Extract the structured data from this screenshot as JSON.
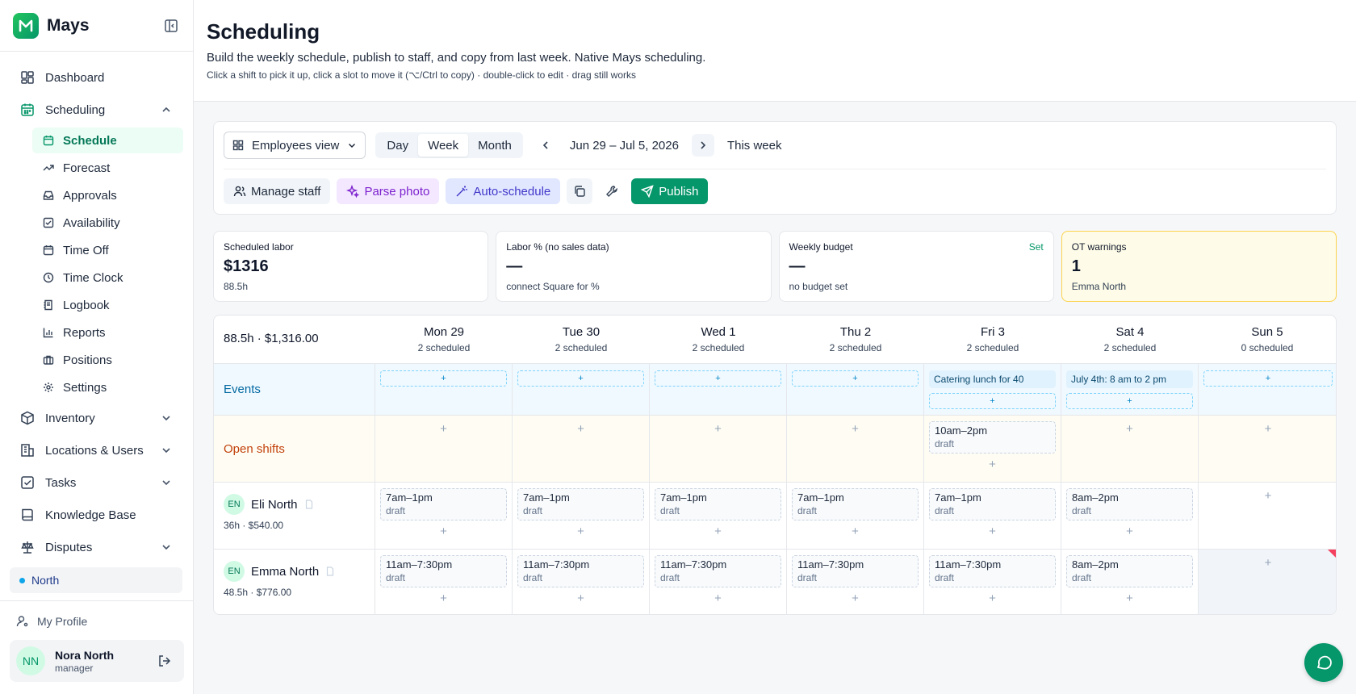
{
  "brand": {
    "name": "Mays"
  },
  "sidebar": {
    "nav": [
      {
        "label": "Dashboard"
      },
      {
        "label": "Scheduling"
      }
    ],
    "scheduling_sub": [
      {
        "label": "Schedule"
      },
      {
        "label": "Forecast"
      },
      {
        "label": "Approvals"
      },
      {
        "label": "Availability"
      },
      {
        "label": "Time Off"
      },
      {
        "label": "Time Clock"
      },
      {
        "label": "Logbook"
      },
      {
        "label": "Reports"
      },
      {
        "label": "Positions"
      },
      {
        "label": "Settings"
      }
    ],
    "nav_bottom": [
      {
        "label": "Inventory"
      },
      {
        "label": "Locations & Users"
      },
      {
        "label": "Tasks"
      },
      {
        "label": "Knowledge Base"
      },
      {
        "label": "Disputes"
      }
    ],
    "location": "North",
    "my_profile": "My Profile",
    "user": {
      "initials": "NN",
      "name": "Nora North",
      "role": "manager"
    }
  },
  "page": {
    "title": "Scheduling",
    "subtitle": "Build the weekly schedule, publish to staff, and copy from last week. Native Mays scheduling.",
    "hint": "Click a shift to pick it up, click a slot to move it (⌥/Ctrl to copy) · double-click to edit · drag still works"
  },
  "toolbar": {
    "view_select": "Employees view",
    "modes": [
      "Day",
      "Week",
      "Month"
    ],
    "active_mode": "Week",
    "date_range": "Jun 29 – Jul 5, 2026",
    "this_week": "This week",
    "manage_staff": "Manage staff",
    "parse_photo": "Parse photo",
    "auto_schedule": "Auto-schedule",
    "publish": "Publish"
  },
  "stats": [
    {
      "label": "Scheduled labor",
      "value": "$1316",
      "note": "88.5h"
    },
    {
      "label": "Labor % (no sales data)",
      "value": "—",
      "note": "connect Square for %"
    },
    {
      "label": "Weekly budget",
      "value": "—",
      "note": "no budget set",
      "link": "Set"
    },
    {
      "label": "OT warnings",
      "value": "1",
      "note": "Emma North"
    }
  ],
  "grid": {
    "summary": "88.5h · $1,316.00",
    "days": [
      {
        "name": "Mon 29",
        "count": "2 scheduled"
      },
      {
        "name": "Tue 30",
        "count": "2 scheduled"
      },
      {
        "name": "Wed 1",
        "count": "2 scheduled"
      },
      {
        "name": "Thu 2",
        "count": "2 scheduled"
      },
      {
        "name": "Fri 3",
        "count": "2 scheduled"
      },
      {
        "name": "Sat 4",
        "count": "2 scheduled"
      },
      {
        "name": "Sun 5",
        "count": "0 scheduled"
      }
    ],
    "events_label": "Events",
    "add_symbol": "+",
    "events": {
      "fri": "Catering lunch for 40",
      "sat": "July 4th: 8 am to 2 pm"
    },
    "open_shifts_label": "Open shifts",
    "open_shift_fri": {
      "time": "10am–2pm",
      "status": "draft"
    },
    "employees": [
      {
        "initials": "EN",
        "name": "Eli North",
        "meta": "36h · $540.00",
        "shifts": [
          {
            "time": "7am–1pm",
            "status": "draft"
          },
          {
            "time": "7am–1pm",
            "status": "draft"
          },
          {
            "time": "7am–1pm",
            "status": "draft"
          },
          {
            "time": "7am–1pm",
            "status": "draft"
          },
          {
            "time": "7am–1pm",
            "status": "draft"
          },
          {
            "time": "8am–2pm",
            "status": "draft"
          }
        ]
      },
      {
        "initials": "EN",
        "name": "Emma North",
        "meta": "48.5h · $776.00",
        "shifts": [
          {
            "time": "11am–7:30pm",
            "status": "draft"
          },
          {
            "time": "11am–7:30pm",
            "status": "draft"
          },
          {
            "time": "11am–7:30pm",
            "status": "draft"
          },
          {
            "time": "11am–7:30pm",
            "status": "draft"
          },
          {
            "time": "11am–7:30pm",
            "status": "draft"
          },
          {
            "time": "8am–2pm",
            "status": "draft"
          }
        ]
      }
    ]
  },
  "colors": {
    "accent": "#059669",
    "event_bg": "#e0f2fe",
    "open_bg": "#fffdf3",
    "warn_bg": "#fefce8"
  }
}
